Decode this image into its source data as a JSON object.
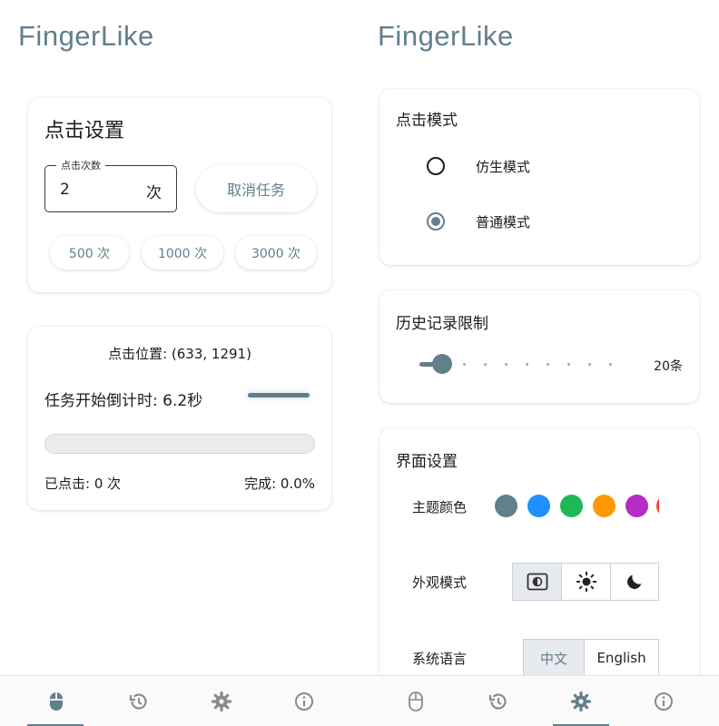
{
  "app": {
    "title": "FingerLike"
  },
  "colors": {
    "accent": "#617f8d",
    "inactive_icon": "#8a8a8a"
  },
  "left": {
    "click_settings": {
      "title": "点击设置",
      "count_field": {
        "legend": "点击次数",
        "value": "2",
        "suffix": "次"
      },
      "cancel_button": "取消任务",
      "presets": [
        "500 次",
        "1000 次",
        "3000 次"
      ]
    },
    "status": {
      "position": "点击位置: (633, 1291)",
      "countdown": "任务开始倒计时: 6.2秒",
      "progress_fraction": 0.0,
      "clicked": "已点击: 0 次",
      "completed": "完成: 0.0%"
    }
  },
  "right": {
    "click_mode": {
      "title": "点击模式",
      "options": [
        {
          "label": "仿生模式",
          "selected": false
        },
        {
          "label": "普通模式",
          "selected": true
        }
      ]
    },
    "history_limit": {
      "title": "历史记录限制",
      "value_label": "20条",
      "slider_fraction": 0.0
    },
    "ui_settings": {
      "title": "界面设置",
      "theme_color_label": "主题颜色",
      "theme_colors": [
        "#617f8d",
        "#1e90ff",
        "#1db954",
        "#ff9800",
        "#b62cc6",
        "#f44336"
      ],
      "appearance_label": "外观模式",
      "appearance_options": [
        "auto-theme-icon",
        "sun-icon",
        "moon-icon"
      ],
      "appearance_selected": 0,
      "language_label": "系统语言",
      "language_options": [
        "中文",
        "English"
      ],
      "language_selected": 0
    }
  },
  "nav": {
    "items": [
      "mouse-icon",
      "history-icon",
      "settings-icon",
      "info-icon"
    ],
    "left_active": 0,
    "right_active": 2
  }
}
